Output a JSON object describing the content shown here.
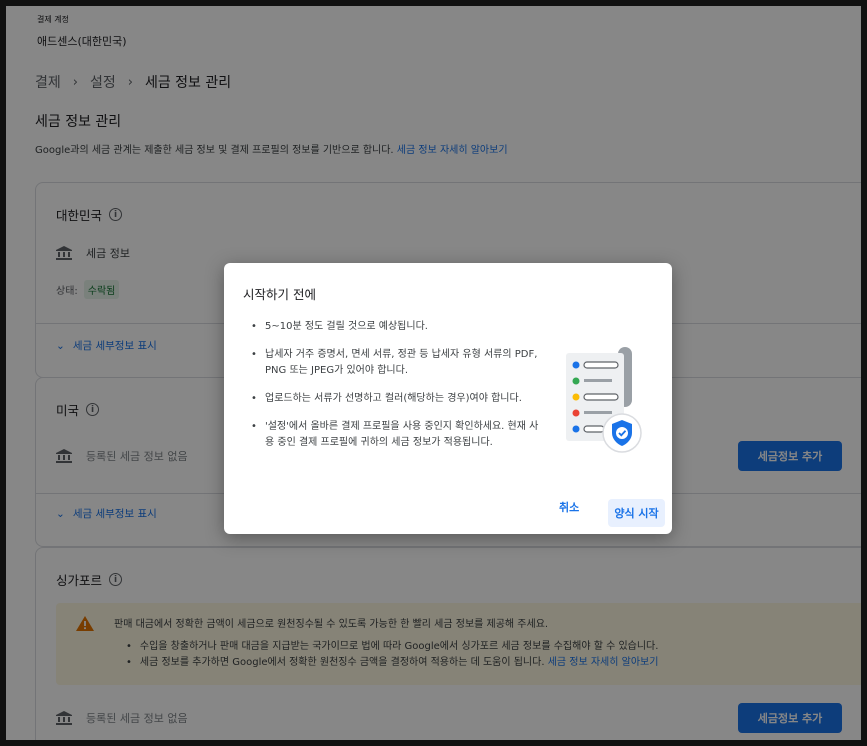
{
  "header": {
    "label": "결제 계정",
    "account": "애드센스(대한민국)"
  },
  "breadcrumb": [
    "결제",
    "설정",
    "세금 정보 관리"
  ],
  "page_title": "세금 정보 관리",
  "intro": {
    "text": "Google과의 세금 관계는 제출한 세금 정보 및 결제 프로필의 정보를 기반으로 합니다. ",
    "link": "세금 정보 자세히 알아보기"
  },
  "cards": {
    "korea": {
      "country": "대한민국",
      "tax_info_label": "세금 정보",
      "status_label": "상태:",
      "status_value": "수락됨",
      "expand_label": "세금 세부정보 표시"
    },
    "usa": {
      "country": "미국",
      "empty_label": "등록된 세금 정보 없음",
      "add_button": "세금정보 추가",
      "expand_label": "세금 세부정보 표시"
    },
    "singapore": {
      "country": "싱가포르",
      "warning_main": "판매 대금에서 정확한 금액이 세금으로 원천징수될 수 있도록 가능한 한 빨리 세금 정보를 제공해 주세요.",
      "warning_bullets": [
        "수입을 창출하거나 판매 대금을 지급받는 국가이므로 법에 따라 Google에서 싱가포르 세금 정보를 수집해야 할 수 있습니다.",
        "세금 정보를 추가하면 Google에서 정확한 원천징수 금액을 결정하여 적용하는 데 도움이 됩니다. "
      ],
      "warning_link": "세금 정보 자세히 알아보기",
      "empty_label": "등록된 세금 정보 없음",
      "add_button": "세금정보 추가"
    }
  },
  "dialog": {
    "title": "시작하기 전에",
    "bullets": [
      "5~10분 정도 걸릴 것으로 예상됩니다.",
      "납세자 거주 증명서, 면세 서류, 정관 등 납세자 유형 서류의 PDF, PNG 또는 JPEG가 있어야 합니다.",
      "업로드하는 서류가 선명하고 컬러(해당하는 경우)여야 합니다.",
      "'설정'에서 올바른 결제 프로필을 사용 중인지 확인하세요. 현재 사용 중인 결제 프로필에 귀하의 세금 정보가 적용됩니다."
    ],
    "cancel": "취소",
    "start": "양식 시작"
  },
  "colors": {
    "accent": "#1a73e8",
    "status_green": "#137333",
    "warning_bg": "#fef7e0",
    "warning_icon": "#e37400"
  }
}
